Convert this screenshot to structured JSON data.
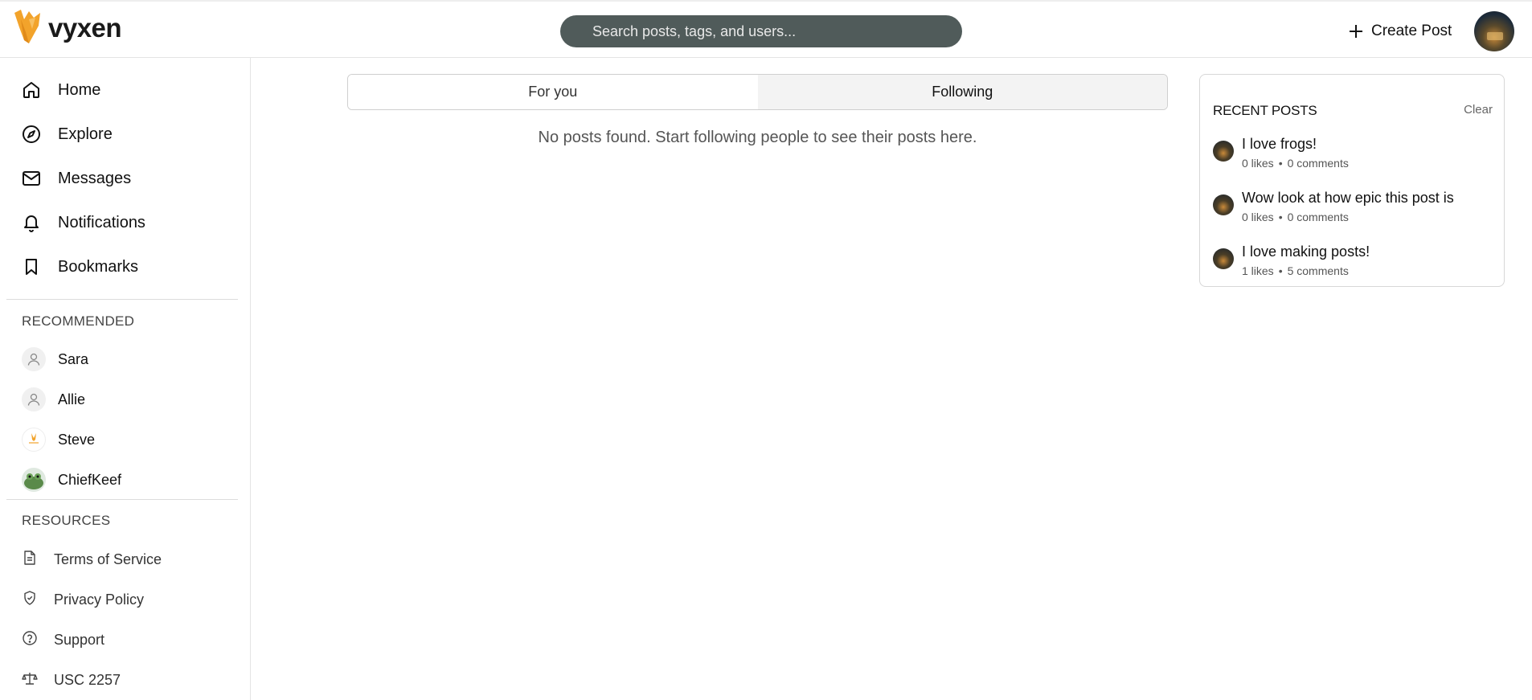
{
  "header": {
    "logo_text": "vyxen",
    "search_placeholder": "Search posts, tags, and users...",
    "create_post_label": "Create Post"
  },
  "sidebar": {
    "nav": [
      {
        "label": "Home",
        "icon": "home-icon"
      },
      {
        "label": "Explore",
        "icon": "compass-icon"
      },
      {
        "label": "Messages",
        "icon": "mail-icon"
      },
      {
        "label": "Notifications",
        "icon": "bell-icon"
      },
      {
        "label": "Bookmarks",
        "icon": "bookmark-icon"
      }
    ],
    "recommended_title": "RECOMMENDED",
    "recommended": [
      {
        "name": "Sara"
      },
      {
        "name": "Allie"
      },
      {
        "name": "Steve"
      },
      {
        "name": "ChiefKeef"
      }
    ],
    "resources_title": "RESOURCES",
    "resources": [
      {
        "label": "Terms of Service",
        "icon": "document-icon"
      },
      {
        "label": "Privacy Policy",
        "icon": "shield-icon"
      },
      {
        "label": "Support",
        "icon": "help-icon"
      },
      {
        "label": "USC 2257",
        "icon": "scale-icon"
      }
    ]
  },
  "main": {
    "tabs": [
      {
        "label": "For you",
        "active": false
      },
      {
        "label": "Following",
        "active": true
      }
    ],
    "empty_message": "No posts found. Start following people to see their posts here."
  },
  "recent_posts": {
    "title": "RECENT POSTS",
    "clear_label": "Clear",
    "posts": [
      {
        "title": "I love frogs!",
        "likes": "0 likes",
        "comments": "0 comments"
      },
      {
        "title": "Wow look at how epic this post is",
        "likes": "0 likes",
        "comments": "0 comments"
      },
      {
        "title": "I love making posts!",
        "likes": "1 likes",
        "comments": "5 comments"
      }
    ]
  },
  "colors": {
    "search_bg": "#505b5a",
    "logo_accent": "#f2a32b",
    "active_tab_bg": "#f3f3f3"
  }
}
